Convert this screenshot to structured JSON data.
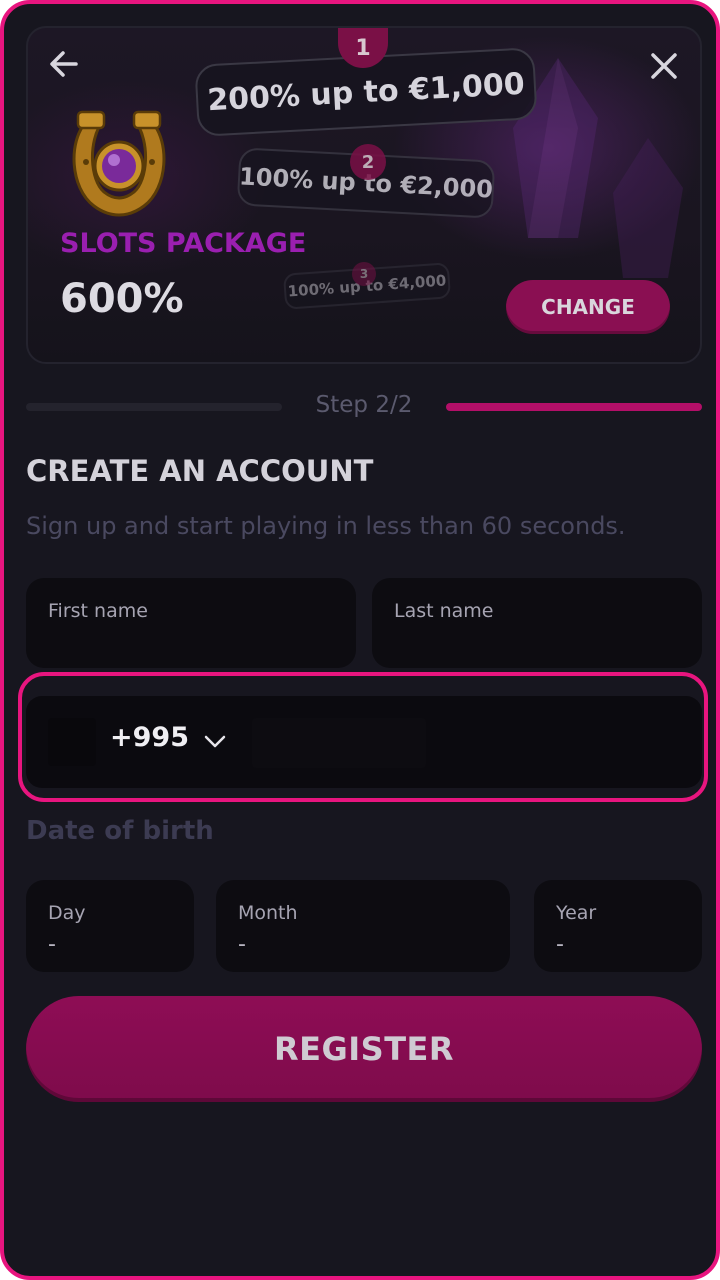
{
  "banner": {
    "offers": [
      {
        "step": "1",
        "text": "200% up to €1,000"
      },
      {
        "step": "2",
        "text": "100% up to €2,000"
      },
      {
        "step": "3",
        "text": "100% up to €4,000"
      }
    ],
    "package_title": "SLOTS PACKAGE",
    "package_percent": "600%",
    "change_label": "CHANGE",
    "icons": {
      "back": "arrow-left-icon",
      "close": "close-icon",
      "package": "horseshoe-gem-icon"
    }
  },
  "stepper": {
    "label": "Step 2/2",
    "current": 2,
    "total": 2
  },
  "form": {
    "title": "CREATE AN ACCOUNT",
    "subtitle": "Sign up and start playing in less than 60 seconds.",
    "first_name_label": "First name",
    "last_name_label": "Last name",
    "phone": {
      "country_code": "+995",
      "value": ""
    },
    "dob": {
      "label": "Date of birth",
      "day_label": "Day",
      "day_value": "-",
      "month_label": "Month",
      "month_value": "-",
      "year_label": "Year",
      "year_value": "-"
    },
    "register_label": "REGISTER"
  },
  "colors": {
    "accent": "#e8157f",
    "button": "#8a0f52",
    "background": "#17161f",
    "package_title": "#9a1fb0"
  }
}
